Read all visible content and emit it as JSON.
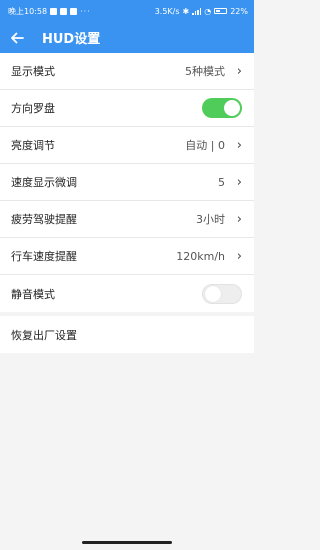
{
  "status_bar": {
    "time": "晚上10:58",
    "dots": "···",
    "network_speed": "3.5K/s",
    "battery": "22%"
  },
  "toolbar": {
    "back_icon": "arrow-left-icon",
    "title": "HUD设置"
  },
  "settings": [
    {
      "label": "显示模式",
      "value": "5种模式"
    },
    {
      "label": "方向罗盘",
      "toggle": true
    },
    {
      "label": "亮度调节",
      "value": "自动 | 0"
    },
    {
      "label": "速度显示微调",
      "value": "5"
    },
    {
      "label": "疲劳驾驶提醒",
      "value": "3小时"
    },
    {
      "label": "行车速度提醒",
      "value": "120km/h"
    },
    {
      "label": "静音模式",
      "toggle": false
    }
  ],
  "reset_label": "恢复出厂设置",
  "colors": {
    "primary": "#3a93f0",
    "toggle_on": "#4fcc5a"
  }
}
